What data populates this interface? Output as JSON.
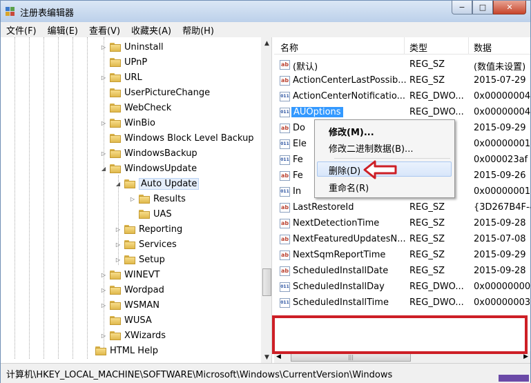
{
  "window": {
    "title": "注册表编辑器",
    "controls": {
      "minimize": "−",
      "maximize": "□",
      "close": "✕"
    }
  },
  "menu": [
    "文件(F)",
    "编辑(E)",
    "查看(V)",
    "收藏夹(A)",
    "帮助(H)"
  ],
  "tree": {
    "items": [
      {
        "label": "Uninstall",
        "expander": "▷"
      },
      {
        "label": "UPnP",
        "expander": ""
      },
      {
        "label": "URL",
        "expander": "▷"
      },
      {
        "label": "UserPictureChange",
        "expander": ""
      },
      {
        "label": "WebCheck",
        "expander": ""
      },
      {
        "label": "WinBio",
        "expander": "▷"
      },
      {
        "label": "Windows Block Level Backup",
        "expander": ""
      },
      {
        "label": "WindowsBackup",
        "expander": "▷"
      },
      {
        "label": "WindowsUpdate",
        "expander": "◢"
      },
      {
        "label": "Auto Update",
        "expander": "◢"
      },
      {
        "label": "Results",
        "expander": "▷"
      },
      {
        "label": "UAS",
        "expander": ""
      },
      {
        "label": "Reporting",
        "expander": "▷"
      },
      {
        "label": "Services",
        "expander": "▷"
      },
      {
        "label": "Setup",
        "expander": "▷"
      },
      {
        "label": "WINEVT",
        "expander": "▷"
      },
      {
        "label": "Wordpad",
        "expander": "▷"
      },
      {
        "label": "WSMAN",
        "expander": "▷"
      },
      {
        "label": "WUSA",
        "expander": ""
      },
      {
        "label": "XWizards",
        "expander": "▷"
      },
      {
        "label": "HTML Help",
        "expander": ""
      }
    ]
  },
  "values_pane": {
    "headers": {
      "name": "名称",
      "type": "类型",
      "data": "数据"
    },
    "rows": [
      {
        "name": "(默认)",
        "type": "REG_SZ",
        "data": "(数值未设置)",
        "icon": "ab"
      },
      {
        "name": "ActionCenterLastPossib...",
        "type": "REG_SZ",
        "data": "2015-07-29",
        "icon": "ab"
      },
      {
        "name": "ActionCenterNotificatio...",
        "type": "REG_DWO...",
        "data": "0x00000004",
        "icon": "bin"
      },
      {
        "name": "AUOptions",
        "type": "REG_DWO...",
        "data": "0x00000004",
        "icon": "bin"
      },
      {
        "name": "Do",
        "type": "",
        "data": "2015-09-29",
        "icon": "ab"
      },
      {
        "name": "Ele",
        "type": "",
        "data": "0x00000001",
        "icon": "bin"
      },
      {
        "name": "Fe",
        "type": "",
        "data": "0x000023af",
        "icon": "bin"
      },
      {
        "name": "Fe",
        "type": "",
        "data": "2015-09-26",
        "icon": "ab"
      },
      {
        "name": "In",
        "type": "",
        "data": "0x00000001",
        "icon": "bin"
      },
      {
        "name": "LastRestoreId",
        "type": "REG_SZ",
        "data": "{3D267B4F-4",
        "icon": "ab"
      },
      {
        "name": "NextDetectionTime",
        "type": "REG_SZ",
        "data": "2015-09-28",
        "icon": "ab"
      },
      {
        "name": "NextFeaturedUpdatesN...",
        "type": "REG_SZ",
        "data": "2015-07-08",
        "icon": "ab"
      },
      {
        "name": "NextSqmReportTime",
        "type": "REG_SZ",
        "data": "2015-09-29",
        "icon": "ab"
      },
      {
        "name": "ScheduledInstallDate",
        "type": "REG_SZ",
        "data": "2015-09-28",
        "icon": "ab"
      },
      {
        "name": "ScheduledInstallDay",
        "type": "REG_DWO...",
        "data": "0x00000000",
        "icon": "bin"
      },
      {
        "name": "ScheduledInstallTime",
        "type": "REG_DWO...",
        "data": "0x00000003",
        "icon": "bin"
      }
    ]
  },
  "context_menu": {
    "items": [
      "修改(M)...",
      "修改二进制数据(B)...",
      "删除(D)",
      "重命名(R)"
    ]
  },
  "status_bar": {
    "path": "计算机\\HKEY_LOCAL_MACHINE\\SOFTWARE\\Microsoft\\Windows\\CurrentVersion\\Windows"
  },
  "colors": {
    "highlight": "#3399ff",
    "annotation_red": "#cd1f26"
  }
}
